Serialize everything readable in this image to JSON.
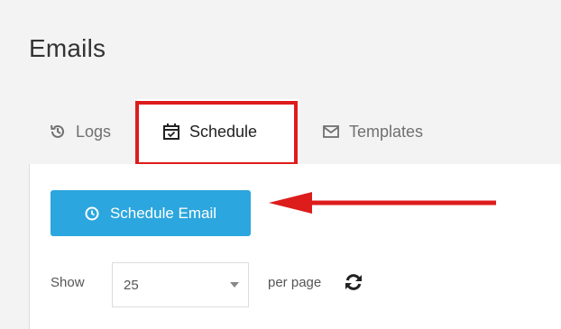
{
  "page": {
    "title": "Emails"
  },
  "tabs": [
    {
      "label": "Logs",
      "icon": "history-icon",
      "active": false
    },
    {
      "label": "Schedule",
      "icon": "calendar-check-icon",
      "active": true
    },
    {
      "label": "Templates",
      "icon": "envelope-icon",
      "active": false
    }
  ],
  "actions": {
    "schedule_email_label": "Schedule Email",
    "button_color": "#2ca6de"
  },
  "pagination": {
    "show_label": "Show",
    "per_page_value": "25",
    "per_page_label": "per page"
  },
  "annotation": {
    "color": "#dd1c1c"
  }
}
